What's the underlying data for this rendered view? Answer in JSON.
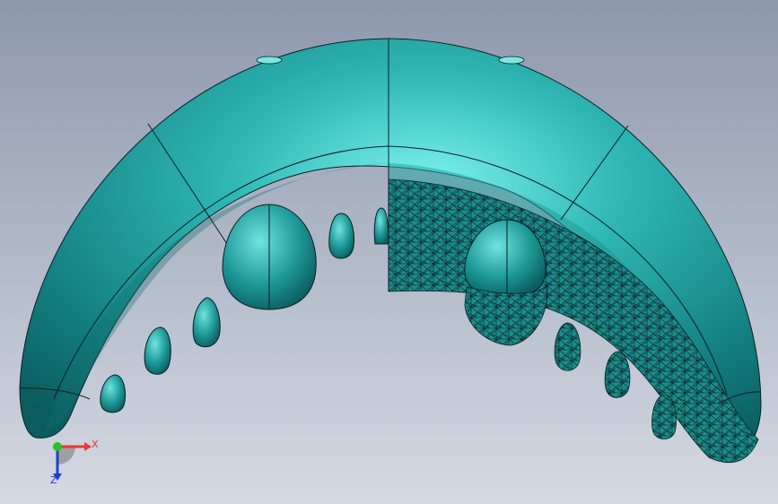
{
  "viewport": {
    "background_top": "#8e98ac",
    "background_bottom": "#d5d9e2"
  },
  "model": {
    "name": "arch-with-teeth",
    "color": "#1f9a9a",
    "highlight_color": "#6fe6e2",
    "edge_color": "#0b1f22",
    "left_half_display": "shaded-with-edges",
    "right_half_display": "mesh"
  },
  "triad": {
    "x_label": "X",
    "z_label": "Z",
    "x_color": "#e53935",
    "y_color": "#2bbf2b",
    "z_color": "#1e3fd1"
  }
}
